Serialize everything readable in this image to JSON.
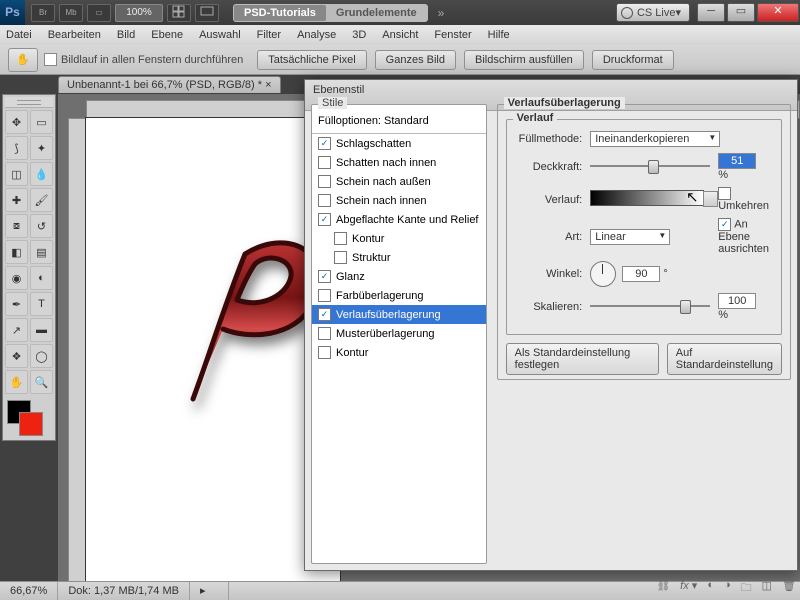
{
  "chrome": {
    "zoom": "100%",
    "switch_active": "PSD-Tutorials",
    "switch_inactive": "Grundelemente",
    "cs_live": "CS Live"
  },
  "menu": [
    "Datei",
    "Bearbeiten",
    "Bild",
    "Ebene",
    "Auswahl",
    "Filter",
    "Analyse",
    "3D",
    "Ansicht",
    "Fenster",
    "Hilfe"
  ],
  "optbar": {
    "scroll_all": "Bildlauf in allen Fenstern durchführen",
    "actual_px": "Tatsächliche Pixel",
    "whole_img": "Ganzes Bild",
    "fill_screen": "Bildschirm ausfüllen",
    "print_fmt": "Druckformat"
  },
  "doc_tab": "Unbenannt-1 bei 66,7% (PSD, RGB/8) * ×",
  "status": {
    "zoom": "66,67%",
    "doc": "Dok: 1,37 MB/1,74 MB"
  },
  "dialog": {
    "title": "Ebenenstil",
    "styles_header": "Stile",
    "fill_opts": "Fülloptionen: Standard",
    "styles": [
      {
        "label": "Schlagschatten",
        "checked": true,
        "indent": false
      },
      {
        "label": "Schatten nach innen",
        "checked": false,
        "indent": false
      },
      {
        "label": "Schein nach außen",
        "checked": false,
        "indent": false
      },
      {
        "label": "Schein nach innen",
        "checked": false,
        "indent": false
      },
      {
        "label": "Abgeflachte Kante und Relief",
        "checked": true,
        "indent": false
      },
      {
        "label": "Kontur",
        "checked": false,
        "indent": true
      },
      {
        "label": "Struktur",
        "checked": false,
        "indent": true
      },
      {
        "label": "Glanz",
        "checked": true,
        "indent": false
      },
      {
        "label": "Farbüberlagerung",
        "checked": false,
        "indent": false
      },
      {
        "label": "Verlaufsüberlagerung",
        "checked": true,
        "indent": false,
        "selected": true
      },
      {
        "label": "Musterüberlagerung",
        "checked": false,
        "indent": false
      },
      {
        "label": "Kontur",
        "checked": false,
        "indent": false
      }
    ],
    "panel_title": "Verlaufsüberlagerung",
    "sub_title": "Verlauf",
    "blend_lbl": "Füllmethode:",
    "blend_val": "Ineinanderkopieren",
    "opacity_lbl": "Deckkraft:",
    "opacity_val": "51",
    "grad_lbl": "Verlauf:",
    "reverse_lbl": "Umkehren",
    "style_lbl": "Art:",
    "style_val": "Linear",
    "align_lbl": "An Ebene ausrichten",
    "angle_lbl": "Winkel:",
    "angle_val": "90",
    "scale_lbl": "Skalieren:",
    "scale_val": "100",
    "btn_default": "Als Standardeinstellung festlegen",
    "btn_reset": "Auf Standardeinstellung"
  }
}
